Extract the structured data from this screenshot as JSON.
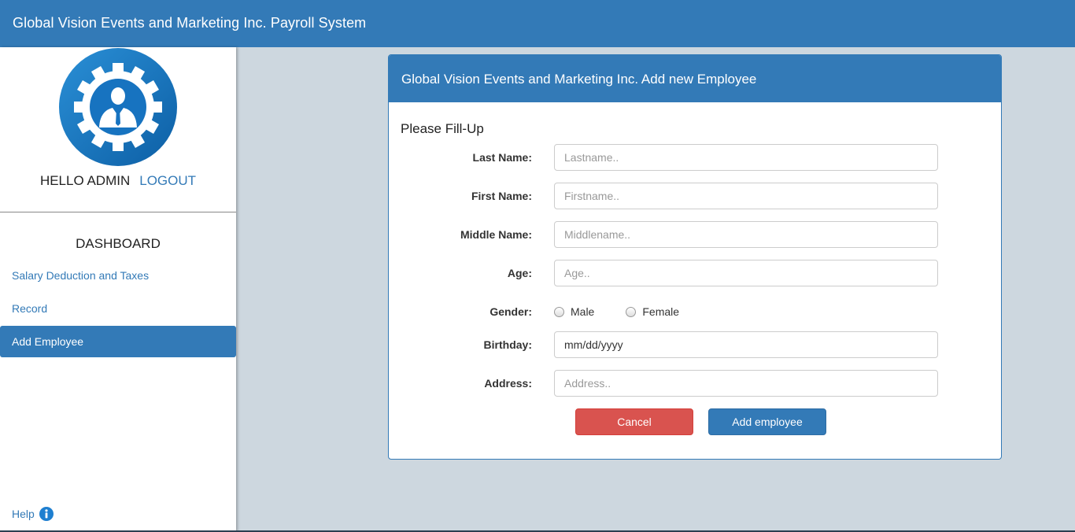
{
  "header": {
    "title": "Global Vision Events and Marketing Inc. Payroll System"
  },
  "sidebar": {
    "logo_icon": "admin-gear-icon",
    "greeting": "HELLO ADMIN",
    "logout_label": "LOGOUT",
    "dashboard_title": "DASHBOARD",
    "items": [
      {
        "label": "Salary Deduction and Taxes",
        "active": false
      },
      {
        "label": "Record",
        "active": false
      },
      {
        "label": "Add Employee",
        "active": true
      }
    ],
    "help_label": "Help",
    "help_icon": "info-icon"
  },
  "panel": {
    "title": "Global Vision Events and Marketing Inc. Add new Employee",
    "subtitle": "Please Fill-Up",
    "fields": {
      "last_name": {
        "label": "Last Name:",
        "placeholder": "Lastname..",
        "value": ""
      },
      "first_name": {
        "label": "First Name:",
        "placeholder": "Firstname..",
        "value": ""
      },
      "middle_name": {
        "label": "Middle Name:",
        "placeholder": "Middlename..",
        "value": ""
      },
      "age": {
        "label": "Age:",
        "placeholder": "Age..",
        "value": ""
      },
      "gender": {
        "label": "Gender:",
        "options": [
          "Male",
          "Female"
        ]
      },
      "birthday": {
        "label": "Birthday:",
        "value": "mm/dd/yyyy"
      },
      "address": {
        "label": "Address:",
        "placeholder": "Address..",
        "value": ""
      }
    },
    "cancel_label": "Cancel",
    "add_label": "Add employee"
  },
  "colors": {
    "primary": "#337ab7",
    "danger": "#d9534f",
    "background": "#cdd7df"
  }
}
